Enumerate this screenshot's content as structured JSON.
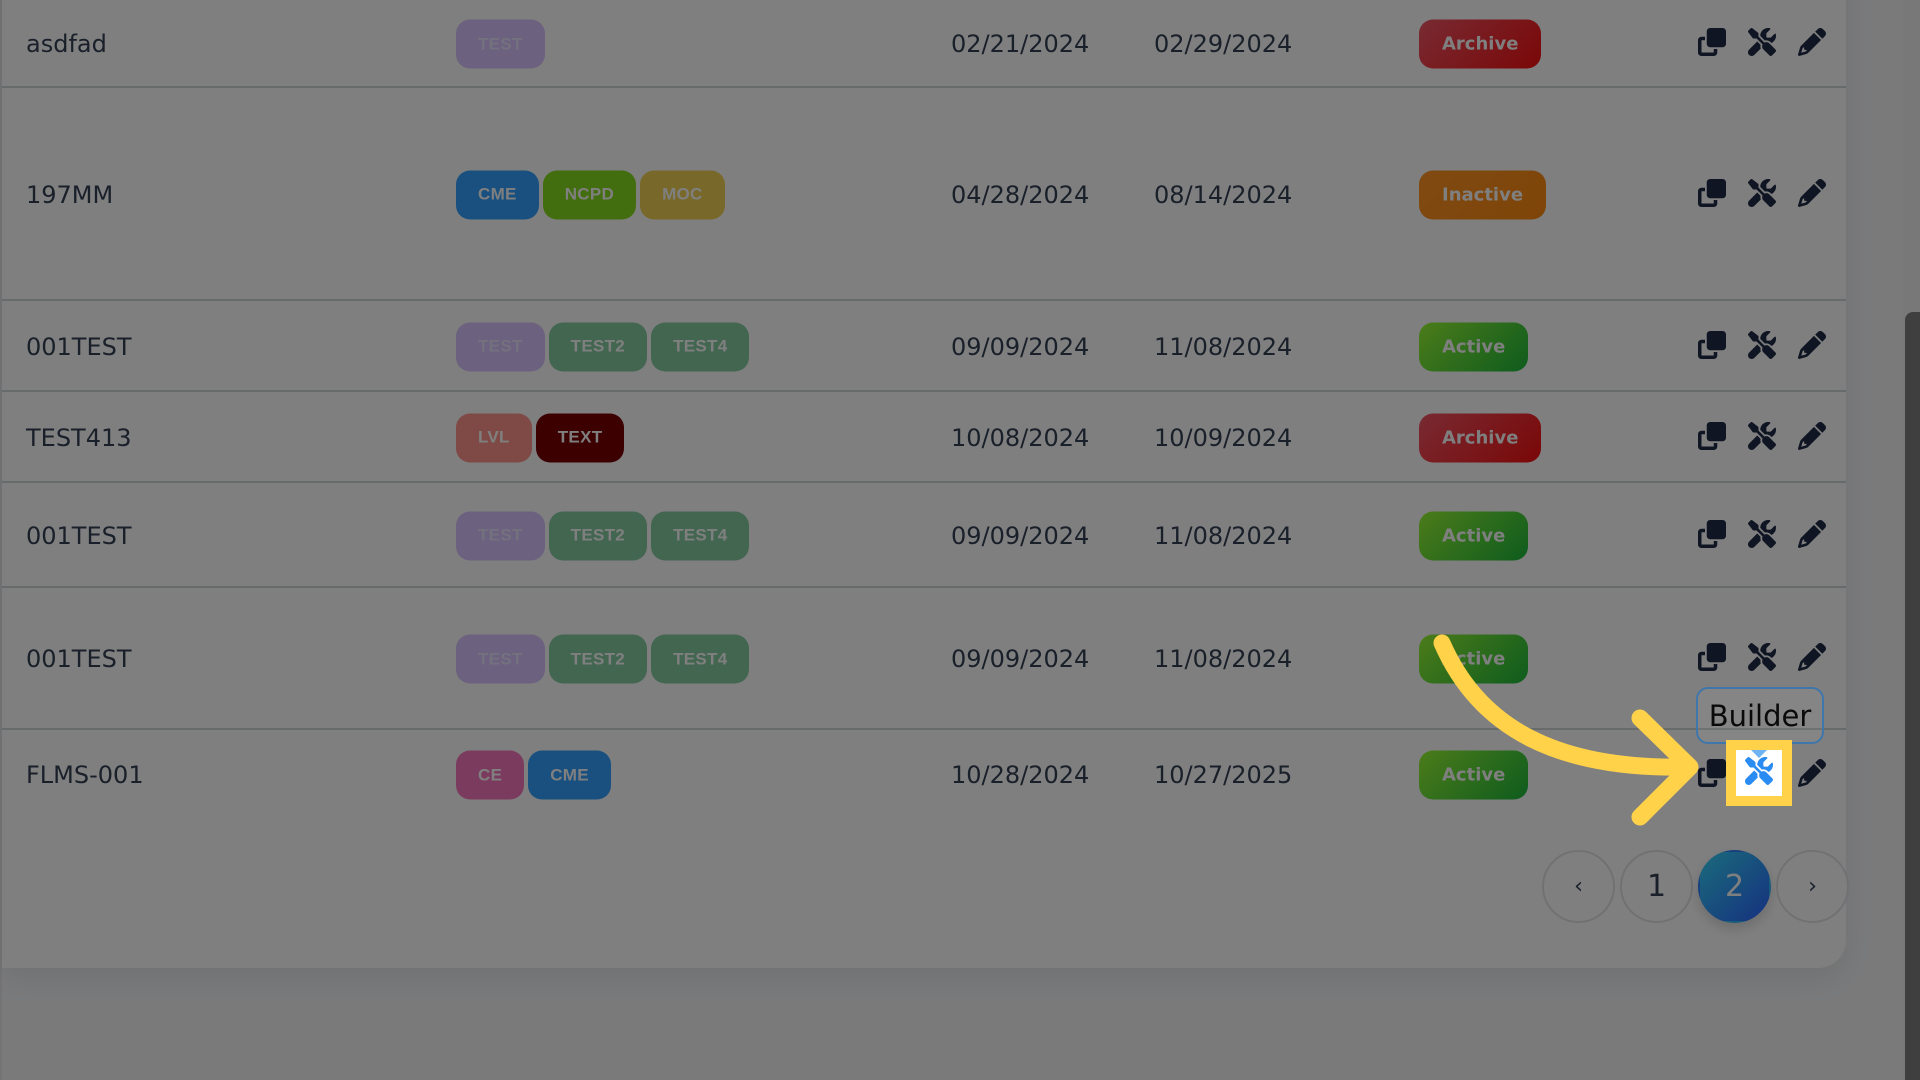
{
  "table": {
    "rows": [
      {
        "name": "asdfad",
        "badges": [
          {
            "label": "TEST",
            "color": "#d9c3ff",
            "text_color": "#e8e2ff"
          }
        ],
        "start_date": "02/21/2024",
        "end_date": "02/29/2024",
        "status": "Archive",
        "status_kind": "archive"
      },
      {
        "name": "197MM",
        "badges": [
          {
            "label": "CME",
            "color": "#33a0ff",
            "text_color": "#ffffff"
          },
          {
            "label": "NCPD",
            "color": "#87dc1e",
            "text_color": "#ffffff"
          },
          {
            "label": "MOC",
            "color": "#f0d254",
            "text_color": "#ffffff"
          }
        ],
        "start_date": "04/28/2024",
        "end_date": "08/14/2024",
        "status": "Inactive",
        "status_kind": "inactive"
      },
      {
        "name": "001TEST",
        "badges": [
          {
            "label": "TEST",
            "color": "#d9c3ff",
            "text_color": "#e8e2ff"
          },
          {
            "label": "TEST2",
            "color": "#86cca2",
            "text_color": "#ffffff"
          },
          {
            "label": "TEST4",
            "color": "#86cca2",
            "text_color": "#ffffff"
          }
        ],
        "start_date": "09/09/2024",
        "end_date": "11/08/2024",
        "status": "Active",
        "status_kind": "active"
      },
      {
        "name": "TEST413",
        "badges": [
          {
            "label": "LVL",
            "color": "#ff958b",
            "text_color": "#ffffff"
          },
          {
            "label": "TEXT",
            "color": "#7a0000",
            "text_color": "#ffffff"
          }
        ],
        "start_date": "10/08/2024",
        "end_date": "10/09/2024",
        "status": "Archive",
        "status_kind": "archive"
      },
      {
        "name": "001TEST",
        "badges": [
          {
            "label": "TEST",
            "color": "#d9c3ff",
            "text_color": "#e8e2ff"
          },
          {
            "label": "TEST2",
            "color": "#86cca2",
            "text_color": "#ffffff"
          },
          {
            "label": "TEST4",
            "color": "#86cca2",
            "text_color": "#ffffff"
          }
        ],
        "start_date": "09/09/2024",
        "end_date": "11/08/2024",
        "status": "Active",
        "status_kind": "active"
      },
      {
        "name": "001TEST",
        "badges": [
          {
            "label": "TEST",
            "color": "#d9c3ff",
            "text_color": "#e8e2ff"
          },
          {
            "label": "TEST2",
            "color": "#86cca2",
            "text_color": "#ffffff"
          },
          {
            "label": "TEST4",
            "color": "#86cca2",
            "text_color": "#ffffff"
          }
        ],
        "start_date": "09/09/2024",
        "end_date": "11/08/2024",
        "status": "Active",
        "status_kind": "active"
      },
      {
        "name": "FLMS-001",
        "badges": [
          {
            "label": "CE",
            "color": "#f677bd",
            "text_color": "#ffffff"
          },
          {
            "label": "CME",
            "color": "#33a0ff",
            "text_color": "#ffffff"
          }
        ],
        "start_date": "10/28/2024",
        "end_date": "10/27/2025",
        "status": "Active",
        "status_kind": "active"
      }
    ],
    "row_actions": [
      {
        "name": "copy",
        "icon": "copy-icon",
        "label": "Copy"
      },
      {
        "name": "builder",
        "icon": "screwdriver-wrench-icon",
        "label": "Builder"
      },
      {
        "name": "edit",
        "icon": "pencil-icon",
        "label": "Edit"
      }
    ]
  },
  "pagination": {
    "prev_label": "‹",
    "next_label": "›",
    "pages": [
      "1",
      "2"
    ],
    "current_page": "2"
  },
  "annotation": {
    "tooltip": "Builder",
    "highlight_target": "builder-button on FLMS-001 row",
    "arrow_color": "#ffd24a",
    "icon_color": "#2a8bf2"
  }
}
